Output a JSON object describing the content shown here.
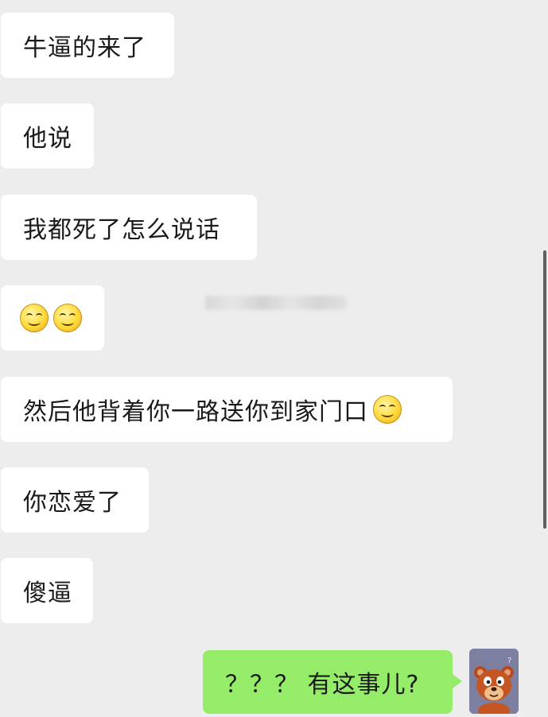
{
  "messages": [
    {
      "side": "left",
      "text": "牛逼的来了"
    },
    {
      "side": "left",
      "text": "他说"
    },
    {
      "side": "left",
      "text": "我都死了怎么说话"
    },
    {
      "side": "left",
      "text": "",
      "emoji": [
        "smile-emoji",
        "smile-emoji"
      ]
    },
    {
      "side": "left",
      "text": "然后他背着你一路送你到家门口",
      "emoji": [
        "smile-emoji"
      ]
    },
    {
      "side": "left",
      "text": "你恋爱了"
    },
    {
      "side": "left",
      "text": "傻逼"
    },
    {
      "side": "right",
      "text": "？？？ 有这事儿?"
    }
  ],
  "colors": {
    "background": "#ededed",
    "incoming_bubble": "#ffffff",
    "outgoing_bubble": "#95ec69"
  },
  "avatar": {
    "icon": "cartoon-bear-avatar-icon"
  }
}
